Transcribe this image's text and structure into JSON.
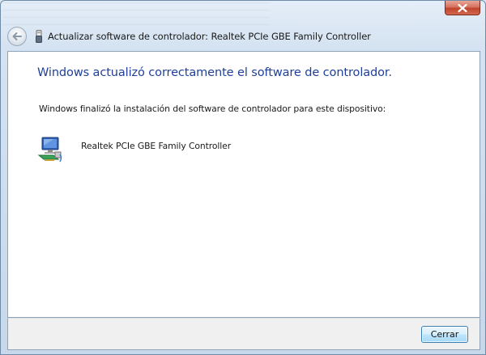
{
  "window": {
    "title": "Actualizar software de controlador: Realtek PCIe GBE Family Controller"
  },
  "content": {
    "heading": "Windows actualizó correctamente el software de controlador.",
    "description": "Windows finalizó la instalación del software de controlador para este dispositivo:",
    "device_name": "Realtek PCIe GBE Family Controller"
  },
  "footer": {
    "close_label": "Cerrar"
  },
  "icons": {
    "back": "back-arrow-icon",
    "usb": "usb-device-icon",
    "device": "network-adapter-icon",
    "close": "close-x-icon"
  },
  "colors": {
    "heading": "#1f3f9a",
    "close_button": "#c0442c",
    "primary_button_border": "#3c7fb1"
  }
}
